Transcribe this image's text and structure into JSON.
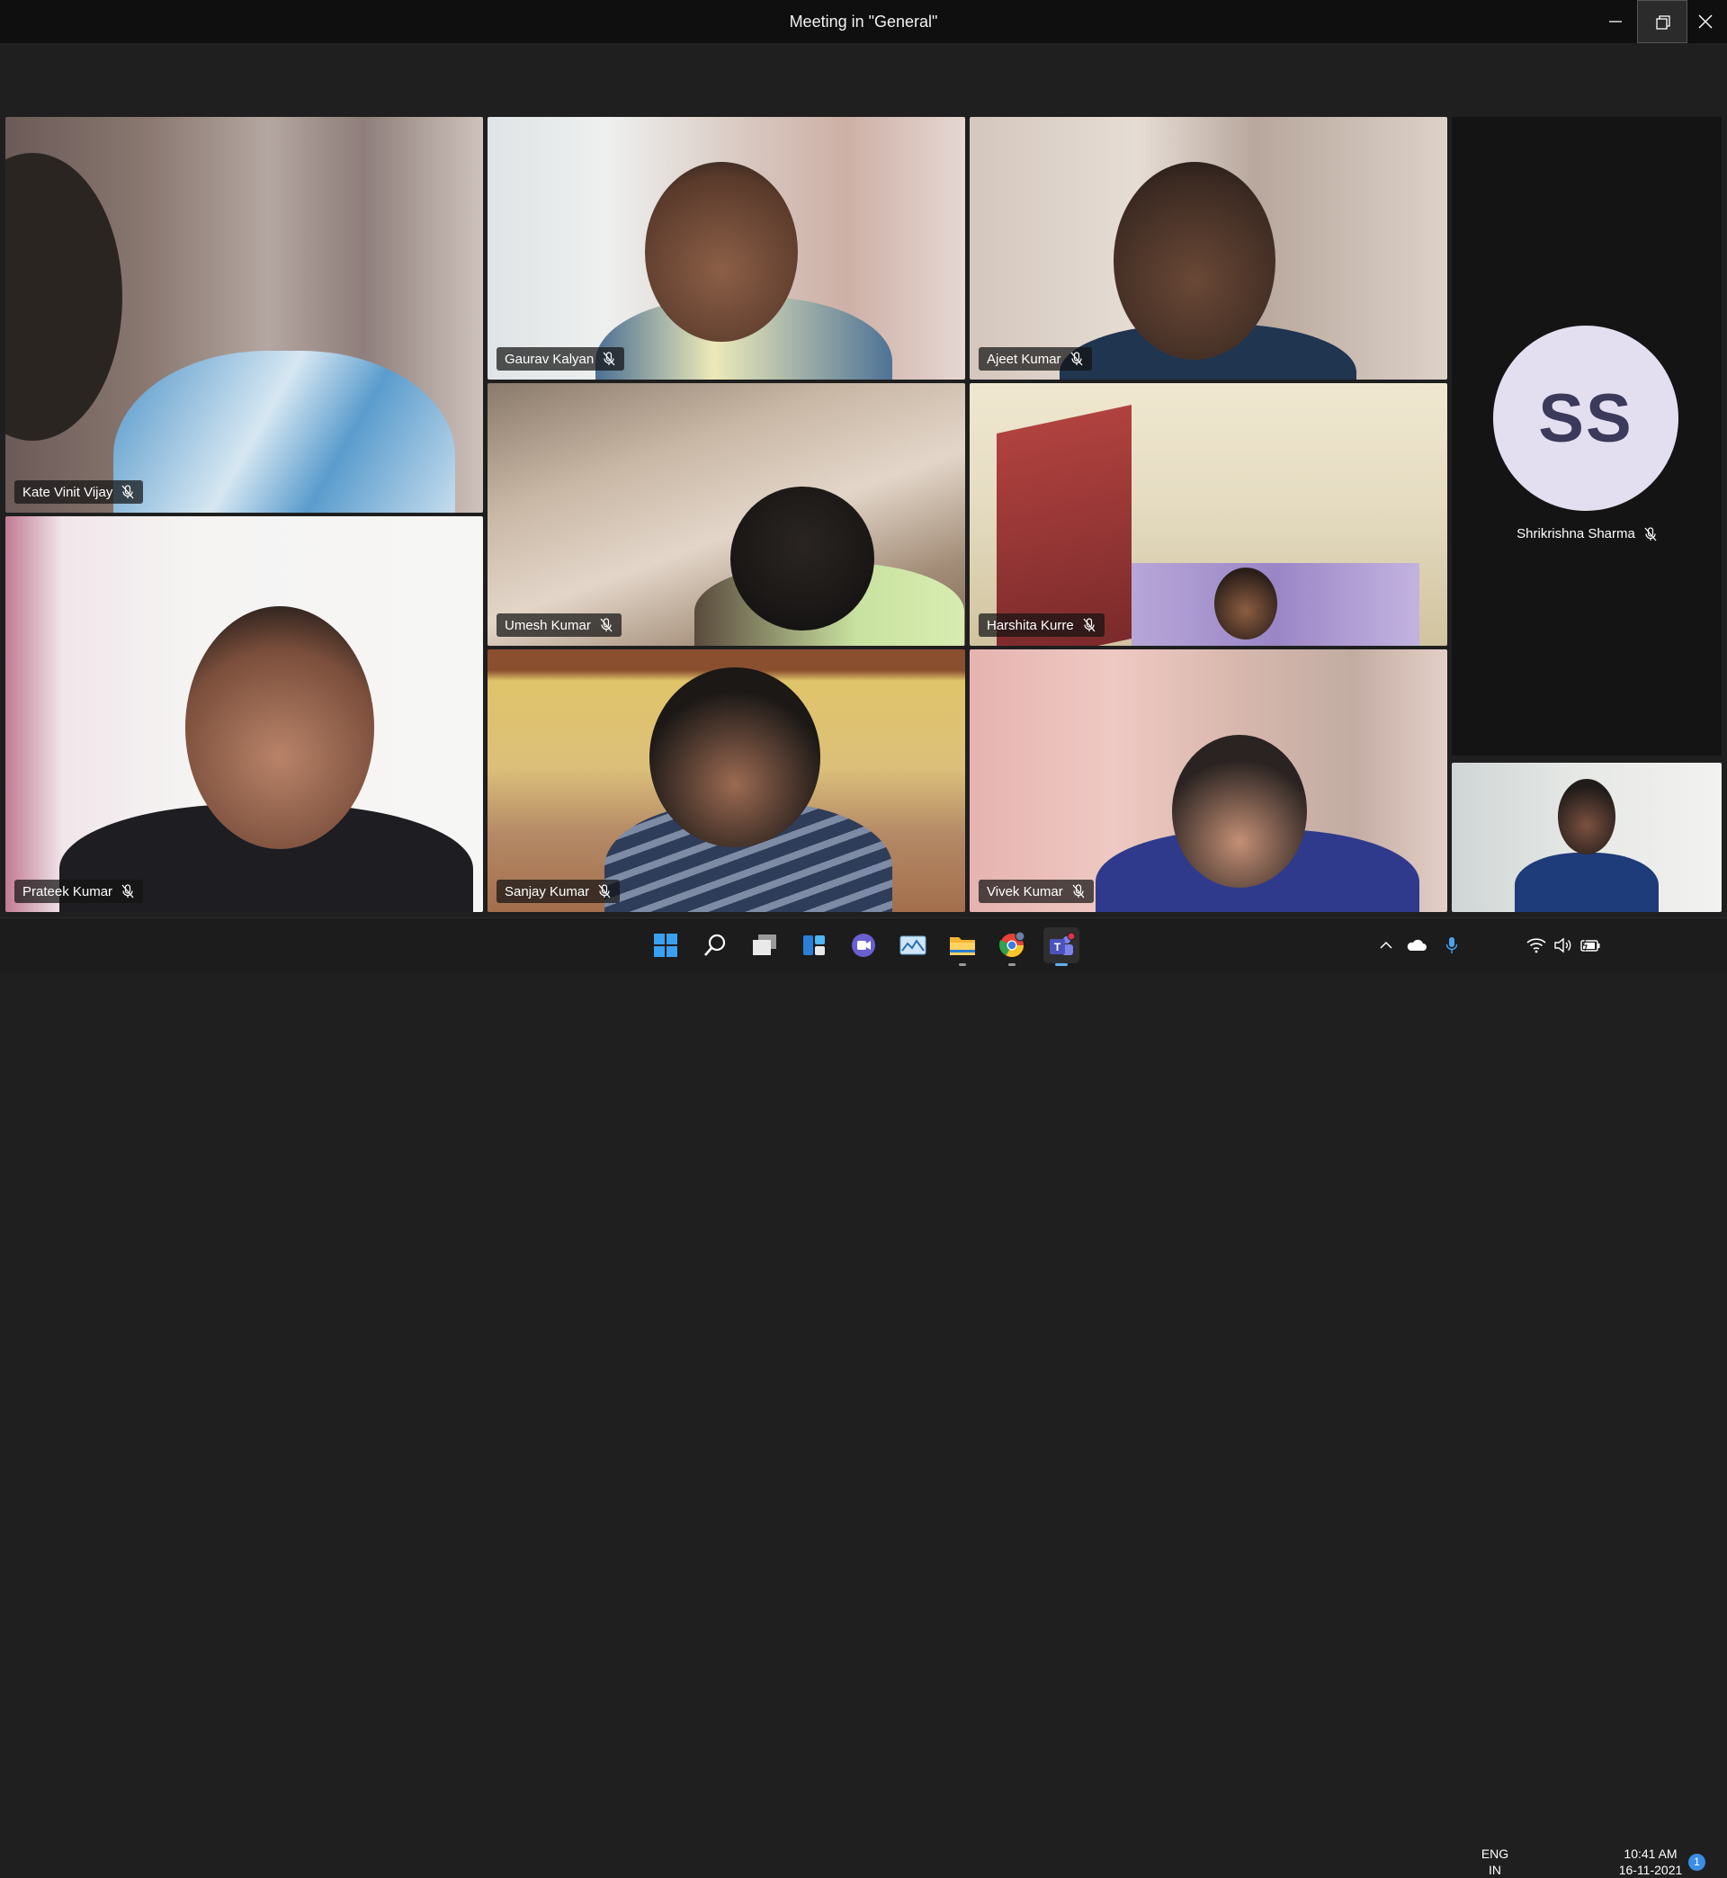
{
  "window": {
    "title": "Meeting in \"General\""
  },
  "participants": [
    {
      "name": "Kate Vinit Vijay",
      "muted": true
    },
    {
      "name": "Gaurav Kalyan",
      "muted": true
    },
    {
      "name": "Ajeet Kumar",
      "muted": true
    },
    {
      "name": "Umesh Kumar",
      "muted": true
    },
    {
      "name": "Harshita Kurre",
      "muted": true
    },
    {
      "name": "Prateek Kumar",
      "muted": true
    },
    {
      "name": "Sanjay Kumar",
      "muted": true
    },
    {
      "name": "Vivek Kumar",
      "muted": true
    }
  ],
  "avatar_participant": {
    "initials": "SS",
    "name": "Shrikrishna Sharma",
    "muted": true,
    "avatar_color": "#e4dff0"
  },
  "taskbar": {
    "apps": [
      "start-icon",
      "search-icon",
      "task-view-icon",
      "widgets-icon",
      "chat-icon",
      "photos-icon",
      "file-explorer-icon",
      "chrome-icon",
      "teams-icon"
    ],
    "language_top": "ENG",
    "language_bottom": "IN",
    "time": "10:41 AM",
    "date": "16-11-2021",
    "notification_count": "1"
  }
}
